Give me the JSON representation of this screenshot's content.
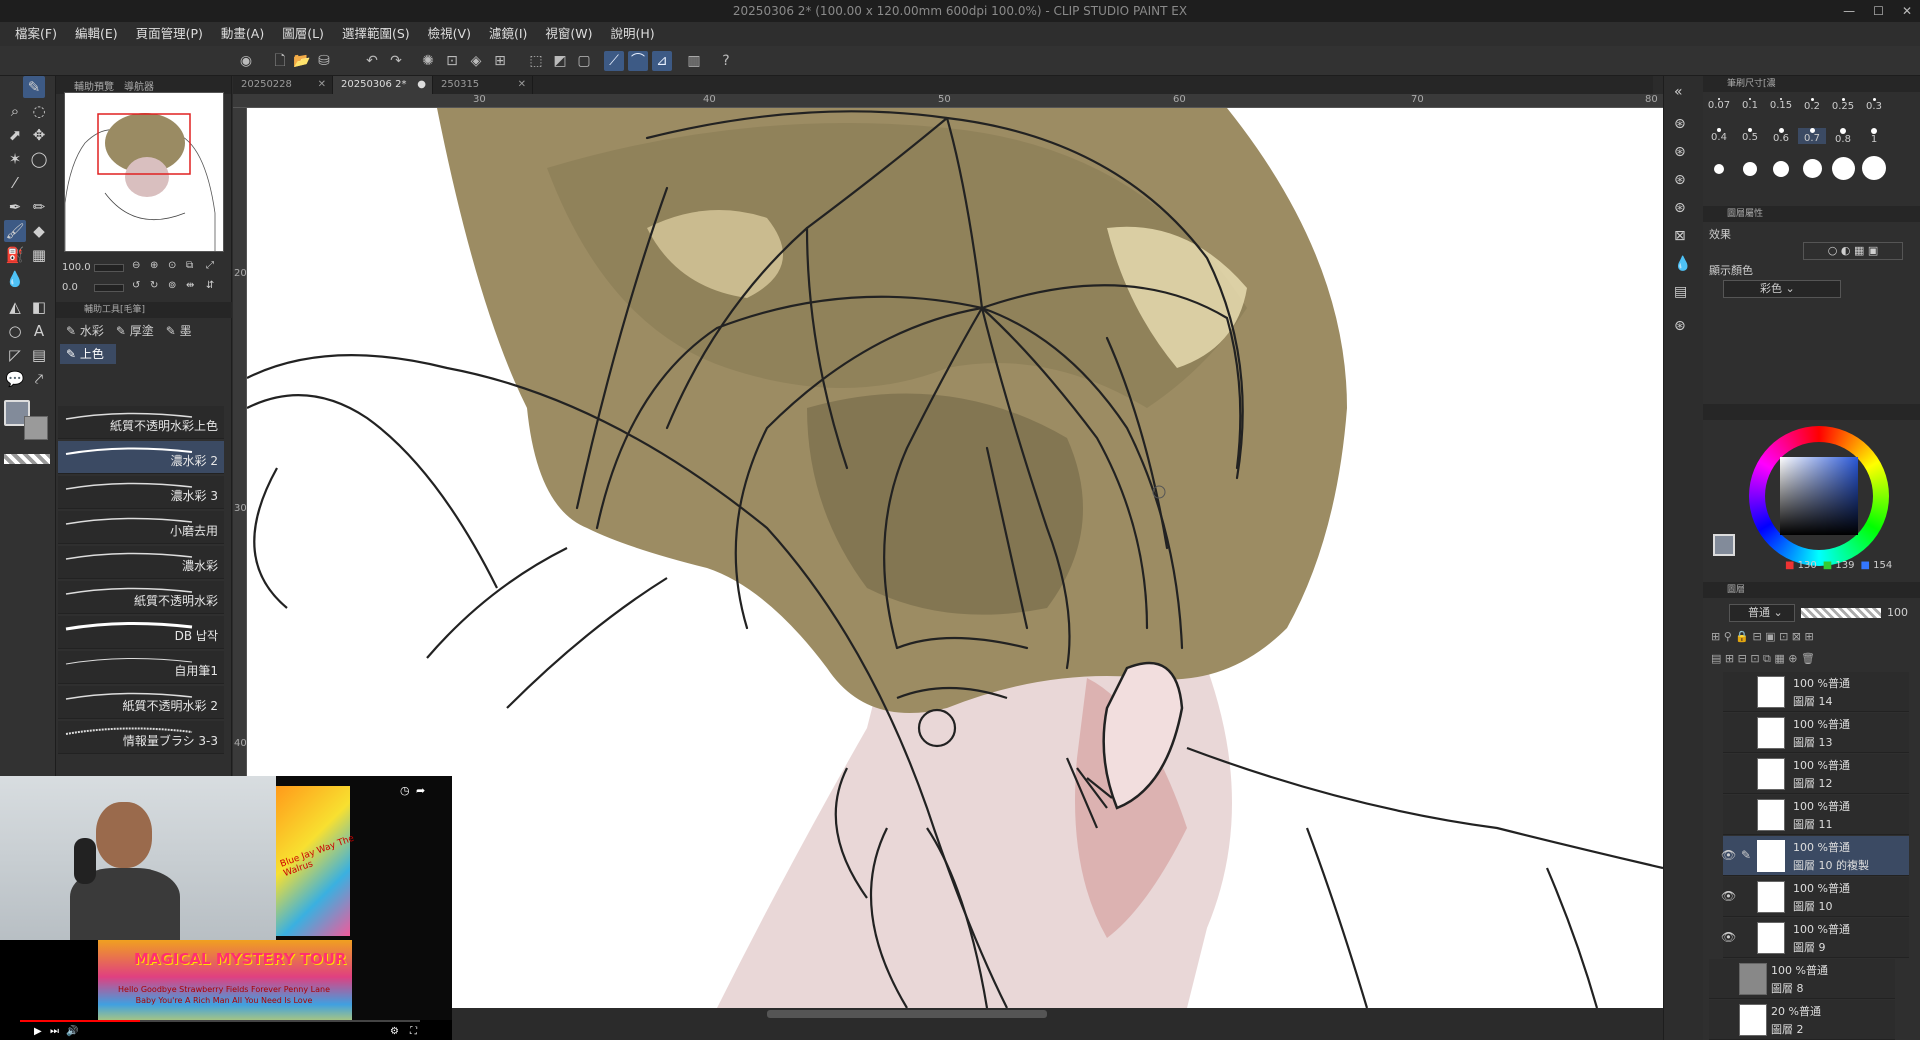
{
  "window": {
    "title": "20250306 2* (100.00 x 120.00mm 600dpi 100.0%) - CLIP STUDIO PAINT EX"
  },
  "menu": [
    "檔案(F)",
    "編輯(E)",
    "頁面管理(P)",
    "動畫(A)",
    "圖層(L)",
    "選擇範圍(S)",
    "檢視(V)",
    "濾鏡(I)",
    "視窗(W)",
    "說明(H)"
  ],
  "subpanel": {
    "tabs": [
      "輔助預覽",
      "導航器"
    ],
    "zoom_value": "100.0",
    "rotate_value": "0.0",
    "subtool_header": "輔助工具[毛筆]",
    "groups": [
      "水彩",
      "厚塗",
      "墨"
    ],
    "active_group": "上色",
    "brushes": [
      "紙質不透明水彩上色",
      "濃水彩 2",
      "濃水彩 3",
      "小磨去用",
      "濃水彩",
      "紙質不透明水彩",
      "DB 납작",
      "自用筆1",
      "紙質不透明水彩 2",
      "情報量ブラシ 3-3"
    ]
  },
  "doc_tabs": [
    "20250228",
    "20250306 2*",
    "250315"
  ],
  "ruler": {
    "top_ticks": [
      "30",
      "40",
      "50",
      "60",
      "70",
      "80"
    ],
    "left_ticks": [
      "20",
      "30",
      "40"
    ]
  },
  "brush_size": {
    "header": "筆刷尺寸[濃",
    "row1": [
      "0.07",
      "0.1",
      "0.15",
      "0.2",
      "0.25",
      "0.3"
    ],
    "row2": [
      "0.4",
      "0.5",
      "0.6",
      "0.7",
      "0.8",
      "1"
    ],
    "selected": "0.7"
  },
  "layer_props": {
    "header": "圖層屬性",
    "effect_label": "效果",
    "display_color_label": "顯示顏色",
    "display_color_value": "彩色"
  },
  "color": {
    "r": "130",
    "g": "139",
    "b": "154",
    "main_hex": "#828b9a"
  },
  "layers_panel": {
    "header_tabs": [
      "圖層"
    ],
    "blend_mode": "普通",
    "opacity": "100",
    "layers": [
      {
        "pct": "100 %普通",
        "name": "圖層 14",
        "visible": false,
        "selected": false
      },
      {
        "pct": "100 %普通",
        "name": "圖層 13",
        "visible": false,
        "selected": false
      },
      {
        "pct": "100 %普通",
        "name": "圖層 12",
        "visible": false,
        "selected": false
      },
      {
        "pct": "100 %普通",
        "name": "圖層 11",
        "visible": false,
        "selected": false
      },
      {
        "pct": "100 %普通",
        "name": "圖層 10 的複製",
        "visible": true,
        "selected": true
      },
      {
        "pct": "100 %普通",
        "name": "圖層 10",
        "visible": true,
        "selected": false
      },
      {
        "pct": "100 %普通",
        "name": "圖層 9",
        "visible": true,
        "selected": false
      },
      {
        "pct": "100 %普通",
        "name": "圖層 8",
        "visible": false,
        "selected": false
      },
      {
        "pct": "20 %普通",
        "name": "圖層 2",
        "visible": false,
        "selected": false
      }
    ]
  },
  "webcam": {
    "poster_title": "MAGICAL MYSTERY TOUR",
    "poster_tracks": "Hello Goodbye  Strawberry Fields Forever  Penny Lane  Baby You're A Rich Man  All You Need Is Love",
    "poster_side": "Blue Jay Way  The Walrus"
  }
}
